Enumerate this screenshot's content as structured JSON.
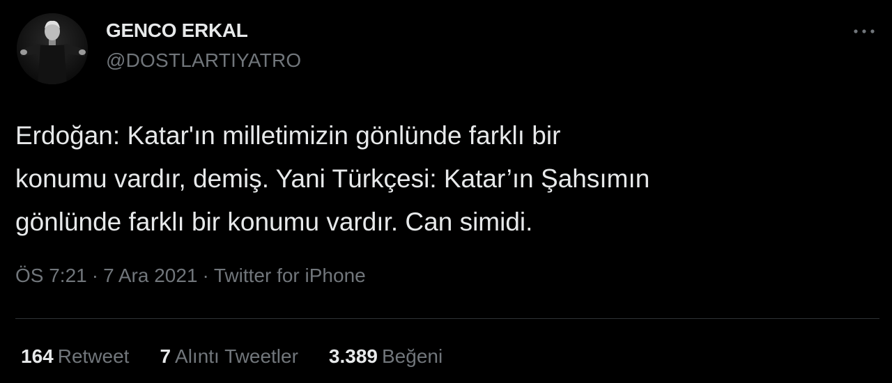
{
  "author": {
    "display_name": "GENCO ERKAL",
    "handle": "@DOSTLARTIYATRO"
  },
  "tweet": {
    "text_lines": [
      "Erdoğan: Katar'ın milletimizin gönlünde farklı bir",
      "konumu vardır, demiş. Yani Türkçesi: Katar’ın Şahsımın",
      "gönlünde farklı bir konumu vardır. Can simidi."
    ],
    "time": "ÖS 7:21",
    "date": "7 Ara 2021",
    "source": "Twitter for iPhone",
    "separator": "·"
  },
  "stats": {
    "retweets": {
      "count": "164",
      "label": "Retweet"
    },
    "quotes": {
      "count": "7",
      "label": "Alıntı Tweetler"
    },
    "likes": {
      "count": "3.389",
      "label": "Beğeni"
    }
  },
  "icons": {
    "more": "more-horizontal-icon"
  },
  "colors": {
    "background": "#000000",
    "primary_text": "#e7e9ea",
    "secondary_text": "#71767b",
    "divider": "#2f3336"
  }
}
